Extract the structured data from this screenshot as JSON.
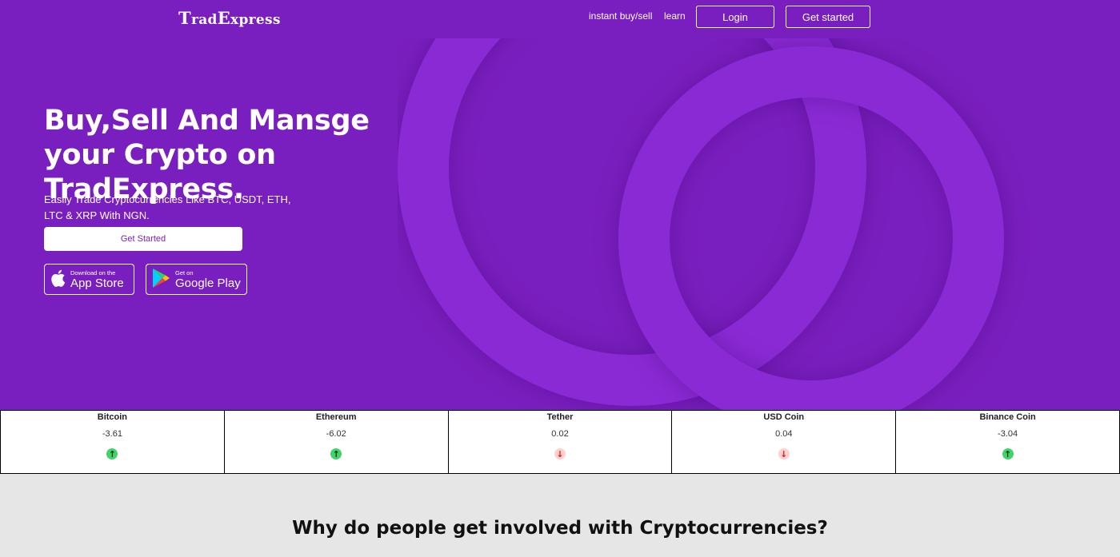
{
  "brand": {
    "logo_first": "T",
    "logo_part1": "rad",
    "logo_big": "E",
    "logo_part2": "xpress"
  },
  "nav": {
    "instant_label": "instant buy/sell",
    "learn_label": "learn",
    "login_label": "Login",
    "get_started_label": "Get started"
  },
  "hero": {
    "headline": "Buy,Sell And Mansge your Crypto on TradExpress.",
    "subtext": "Easily Trade Cryptocurrencies Like BTC, USDT, ETH, LTC & XRP With NGN.",
    "cta_label": "Get Started",
    "appstore_small": "Download on the",
    "appstore_large": "App Store",
    "googleplay_small": "Get on",
    "googleplay_large": "Google Play"
  },
  "ticker": [
    {
      "name": "Bitcoin",
      "value": "-3.61",
      "trend": "up"
    },
    {
      "name": "Ethereum",
      "value": "-6.02",
      "trend": "up"
    },
    {
      "name": "Tether",
      "value": "0.02",
      "trend": "down"
    },
    {
      "name": "USD Coin",
      "value": "0.04",
      "trend": "down"
    },
    {
      "name": "Binance Coin",
      "value": "-3.04",
      "trend": "up"
    }
  ],
  "section": {
    "title": "Why do people get involved with Cryptocurrencies?"
  },
  "colors": {
    "brand_purple": "#7a1fbf",
    "ring_purple": "#8a2ad4",
    "up_green": "#43d36a",
    "down_red": "#e02020"
  },
  "icons": {
    "appstore": "apple-icon",
    "googleplay": "google-play-icon",
    "up": "arrow-up-icon",
    "down": "arrow-down-icon"
  }
}
